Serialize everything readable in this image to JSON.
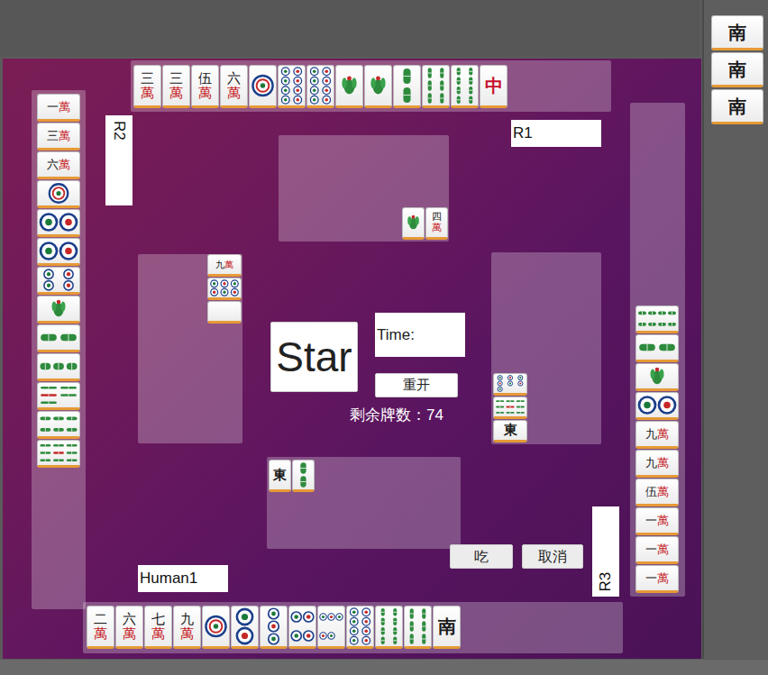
{
  "seats": [
    {
      "label": "R1",
      "hand": [
        {
          "kind": "wan",
          "text": "三萬"
        },
        {
          "kind": "wan",
          "text": "三萬"
        },
        {
          "kind": "wan",
          "text": "伍萬"
        },
        {
          "kind": "wan",
          "text": "六萬"
        },
        {
          "kind": "dots",
          "value": 1
        },
        {
          "kind": "dots",
          "value": 8
        },
        {
          "kind": "dots",
          "value": 8
        },
        {
          "kind": "bamboo",
          "value": 1
        },
        {
          "kind": "bamboo",
          "value": 1
        },
        {
          "kind": "bamboo",
          "value": 2
        },
        {
          "kind": "bamboo",
          "value": 6
        },
        {
          "kind": "bamboo",
          "value": 8
        },
        {
          "kind": "honor",
          "text": "中",
          "color": "#c8102e"
        }
      ],
      "discards": [
        {
          "kind": "bamboo",
          "value": 1
        },
        {
          "kind": "wan",
          "text": "四萬"
        }
      ]
    },
    {
      "label": "R2",
      "hand": [
        {
          "kind": "wan",
          "text": "一萬"
        },
        {
          "kind": "wan",
          "text": "三萬"
        },
        {
          "kind": "wan",
          "text": "六萬"
        },
        {
          "kind": "dots",
          "value": 1
        },
        {
          "kind": "dots",
          "value": 2
        },
        {
          "kind": "dots",
          "value": 2
        },
        {
          "kind": "dots",
          "value": 4
        },
        {
          "kind": "bamboo",
          "value": 1
        },
        {
          "kind": "bamboo",
          "value": 2
        },
        {
          "kind": "bamboo",
          "value": 3
        },
        {
          "kind": "bamboo",
          "value": 5
        },
        {
          "kind": "bamboo",
          "value": 6
        },
        {
          "kind": "bamboo",
          "value": 9
        }
      ],
      "discards": [
        {
          "kind": "wan",
          "text": "九萬"
        },
        {
          "kind": "dots",
          "value": 6
        },
        {
          "kind": "blank"
        }
      ]
    },
    {
      "label": "R3",
      "hand": [
        {
          "kind": "bamboo",
          "value": 8
        },
        {
          "kind": "bamboo",
          "value": 2
        },
        {
          "kind": "bamboo",
          "value": 1
        },
        {
          "kind": "dots",
          "value": 2
        },
        {
          "kind": "wan",
          "text": "九萬"
        },
        {
          "kind": "wan",
          "text": "九萬"
        },
        {
          "kind": "wan",
          "text": "伍萬"
        },
        {
          "kind": "wan",
          "text": "一萬"
        },
        {
          "kind": "wan",
          "text": "一萬"
        },
        {
          "kind": "wan",
          "text": "一萬"
        }
      ],
      "discards": [
        {
          "kind": "dots",
          "value": 7
        },
        {
          "kind": "bamboo",
          "value": 9
        },
        {
          "kind": "honor",
          "text": "東",
          "color": "#1a1a1a"
        }
      ]
    },
    {
      "label": "Human1",
      "hand": [
        {
          "kind": "wan",
          "text": "二萬"
        },
        {
          "kind": "wan",
          "text": "六萬"
        },
        {
          "kind": "wan",
          "text": "七萬"
        },
        {
          "kind": "wan",
          "text": "九萬"
        },
        {
          "kind": "dots",
          "value": 1
        },
        {
          "kind": "dots",
          "value": 2
        },
        {
          "kind": "dots",
          "value": 3
        },
        {
          "kind": "dots",
          "value": 4
        },
        {
          "kind": "dots",
          "value": 5
        },
        {
          "kind": "dots",
          "value": 8
        },
        {
          "kind": "bamboo",
          "value": 8
        },
        {
          "kind": "bamboo",
          "value": 6
        },
        {
          "kind": "honor",
          "text": "南",
          "color": "#1a1a1a"
        }
      ],
      "discards": [
        {
          "kind": "honor",
          "text": "東",
          "color": "#1a1a1a"
        },
        {
          "kind": "bamboo",
          "value": 2
        }
      ]
    }
  ],
  "wall": [
    {
      "kind": "honor",
      "text": "南",
      "color": "#1a1a1a"
    },
    {
      "kind": "honor",
      "text": "南",
      "color": "#1a1a1a"
    },
    {
      "kind": "honor",
      "text": "南",
      "color": "#1a1a1a"
    }
  ],
  "center": {
    "start_button": "Star",
    "time_label": "Time:",
    "restart_button": "重开",
    "remaining": "剩余牌数：74"
  },
  "actions": [
    {
      "label": "吃"
    },
    {
      "label": "取消"
    }
  ]
}
